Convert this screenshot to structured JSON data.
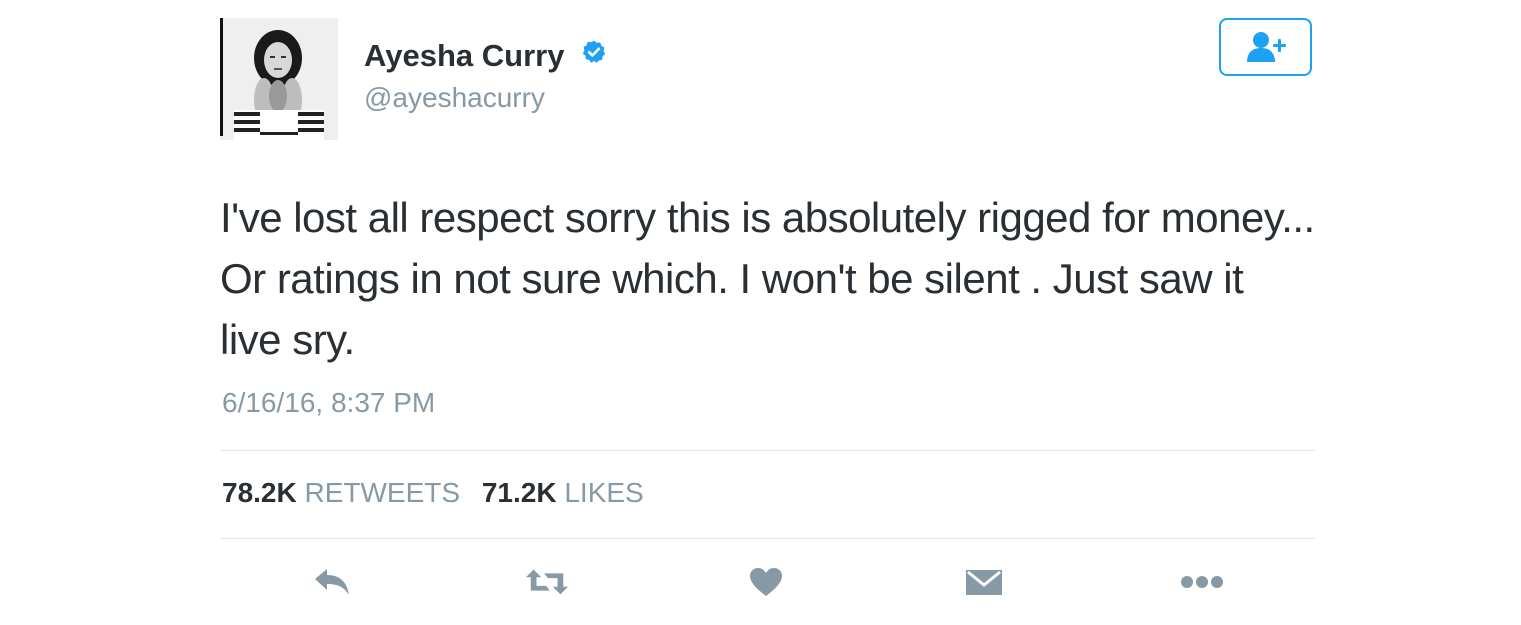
{
  "user": {
    "display_name": "Ayesha Curry",
    "handle": "@ayeshacurry",
    "verified": true,
    "avatar_icon": "profile-photo"
  },
  "follow_button": {
    "icon": "add-user-icon"
  },
  "tweet": {
    "text": "I've lost all respect sorry this is absolutely rigged for money... Or ratings in not sure which. I won't be silent . Just saw it live sry.",
    "timestamp": "6/16/16, 8:37 PM"
  },
  "stats": {
    "retweets_count": "78.2K",
    "retweets_label": "RETWEETS",
    "likes_count": "71.2K",
    "likes_label": "LIKES"
  },
  "actions": [
    {
      "icon": "reply-icon"
    },
    {
      "icon": "retweet-icon"
    },
    {
      "icon": "heart-icon"
    },
    {
      "icon": "message-icon"
    },
    {
      "icon": "more-icon"
    }
  ],
  "colors": {
    "text": "#292f33",
    "secondary": "#8899a6",
    "accent": "#1da1f2",
    "divider": "#e1e8ed",
    "action_icons": "#8899a6"
  }
}
